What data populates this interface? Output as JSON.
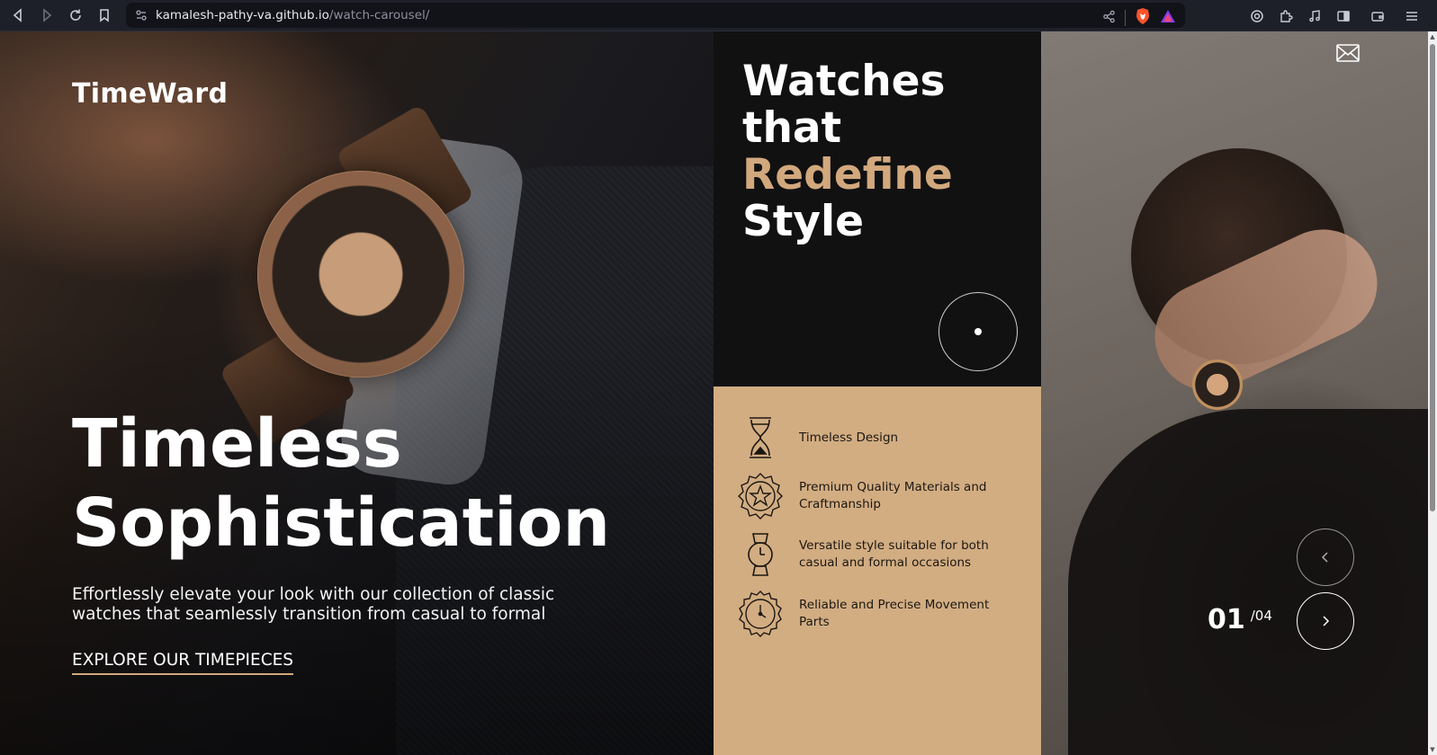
{
  "browser": {
    "url_host": "kamalesh-pathy-va.github.io",
    "url_path": "/watch-carousel/",
    "icons": [
      "back-icon",
      "forward-icon",
      "reload-icon",
      "bookmark-icon",
      "site-info-icon",
      "share-icon",
      "brave-shield-icon",
      "brave-rewards-icon",
      "leo-icon",
      "extensions-icon",
      "media-icon",
      "sidebar-icon",
      "wallet-icon",
      "menu-icon"
    ]
  },
  "brand": "TimeWard",
  "hero": {
    "title_line1": "Timeless",
    "title_line2": "Sophistication",
    "subtitle": "Effortlessly elevate your look with our collection of classic watches that seamlessly transition from casual to formal",
    "cta": "EXPLORE OUR TIMEPIECES"
  },
  "headline": {
    "line1": "Watches",
    "line2": "that",
    "line3": "Redefine",
    "line4": "Style"
  },
  "features": [
    {
      "icon": "hourglass-icon",
      "text": "Timeless Design"
    },
    {
      "icon": "star-badge-icon",
      "text": "Premium Quality Materials and Craftmanship"
    },
    {
      "icon": "wristwatch-icon",
      "text": "Versatile style suitable for both casual and formal occasions"
    },
    {
      "icon": "gear-clock-icon",
      "text": "Reliable and Precise Movement Parts"
    }
  ],
  "carousel": {
    "current": "01",
    "total": "/04"
  },
  "colors": {
    "accent": "#d2a87d",
    "tan_panel": "#d2ad82",
    "dark_panel": "#111112"
  }
}
